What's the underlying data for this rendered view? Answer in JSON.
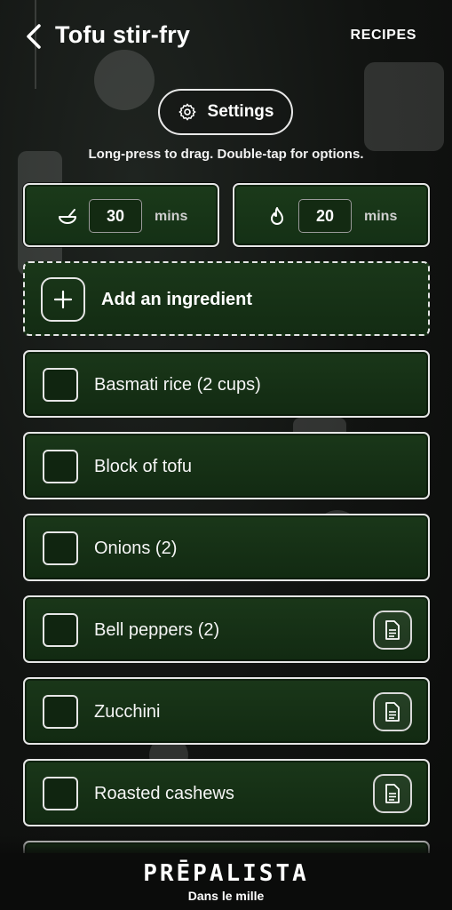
{
  "header": {
    "title": "Tofu stir-fry",
    "recipes_label": "RECIPES"
  },
  "settings": {
    "label": "Settings"
  },
  "hint": "Long-press to drag. Double-tap for options.",
  "times": {
    "prep": {
      "icon": "bowl-icon",
      "value": "30",
      "unit": "mins"
    },
    "cook": {
      "icon": "flame-icon",
      "value": "20",
      "unit": "mins"
    }
  },
  "add_ingredient": {
    "label": "Add an ingredient"
  },
  "ingredients": [
    {
      "label": "Basmati rice (2 cups)",
      "checked": false,
      "has_note": false
    },
    {
      "label": "Block of tofu",
      "checked": false,
      "has_note": false
    },
    {
      "label": "Onions (2)",
      "checked": false,
      "has_note": false
    },
    {
      "label": "Bell peppers (2)",
      "checked": false,
      "has_note": true
    },
    {
      "label": "Zucchini",
      "checked": false,
      "has_note": true
    },
    {
      "label": "Roasted cashews",
      "checked": false,
      "has_note": true
    }
  ],
  "footer": {
    "brand": "PRĒPALISTA",
    "tagline": "Dans le mille"
  },
  "colors": {
    "background": "#111311",
    "card_green": "#1a3719",
    "border": "#e6e6e6"
  }
}
